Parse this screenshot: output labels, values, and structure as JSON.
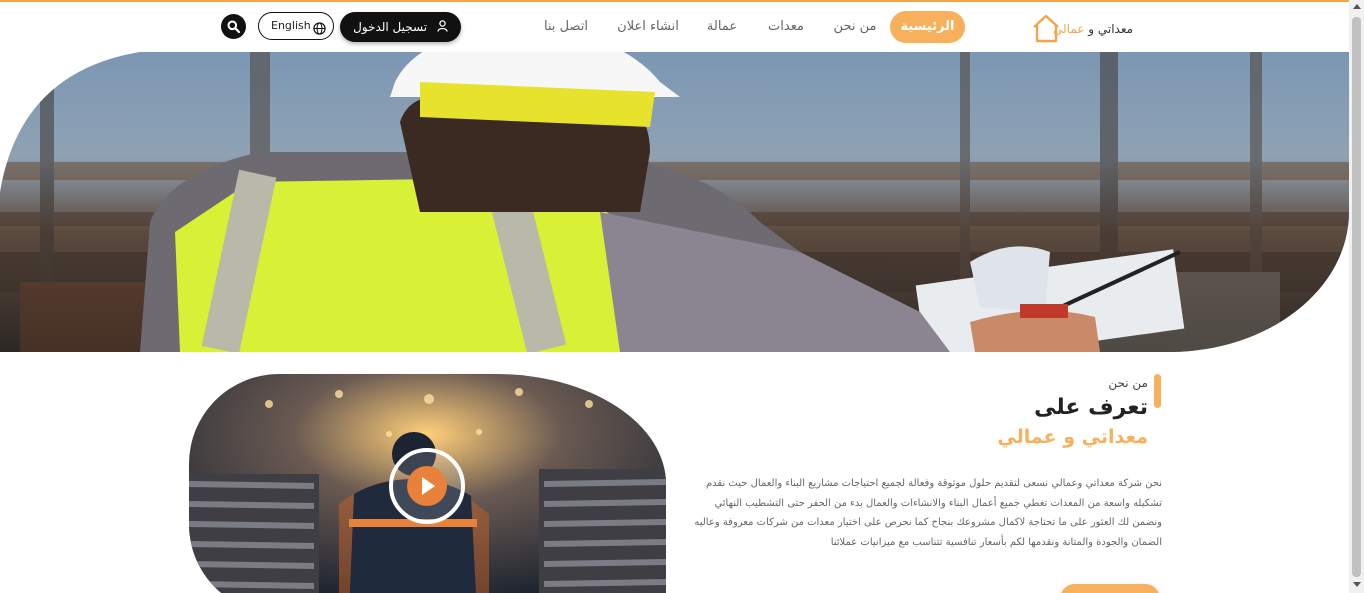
{
  "brand": {
    "name_part1": "معداتي",
    "name_connector": " و ",
    "name_part2": "عمالي",
    "accent_color": "#f7b05b",
    "logo_icon": "house-outline-icon"
  },
  "nav": {
    "items": [
      {
        "label": "الرئيسية",
        "active": true
      },
      {
        "label": "من نحن",
        "active": false
      },
      {
        "label": "معدات",
        "active": false
      },
      {
        "label": "عمالة",
        "active": false
      },
      {
        "label": "انشاء اعلان",
        "active": false
      },
      {
        "label": "اتصل بنا",
        "active": false
      }
    ],
    "login_label": "تسجيل الدخول",
    "login_icon": "user-icon",
    "language_label": "English",
    "language_icon": "globe-icon",
    "search_icon": "search-icon"
  },
  "about": {
    "kicker": "من نحن",
    "title_line1": "تعرف على",
    "title_line2": "معداتي و عمالي",
    "paragraph": "نحن شركة معداتي وعمالي نسعى لتقديم حلول موثوقة وفعالة لجميع احتياجات مشاريع البناء والعمال حيث نقدم تشكيله واسعة من المعدات تغطي جميع أعمال البناء والانشاءات والعمال بدء من الحفر حتى التشطيب النهائي ونضمن لك العثور على ما تحتاجة لاكمال مشروعك بنجاح كما نحرص على اختيار معدات من شركات معروفة وعاليه الضمان والجودة والمتانة ونقدمها لكم بأسعار تنافسية تتناسب مع ميزانيات عملائنا",
    "video_icon": "play-icon"
  }
}
